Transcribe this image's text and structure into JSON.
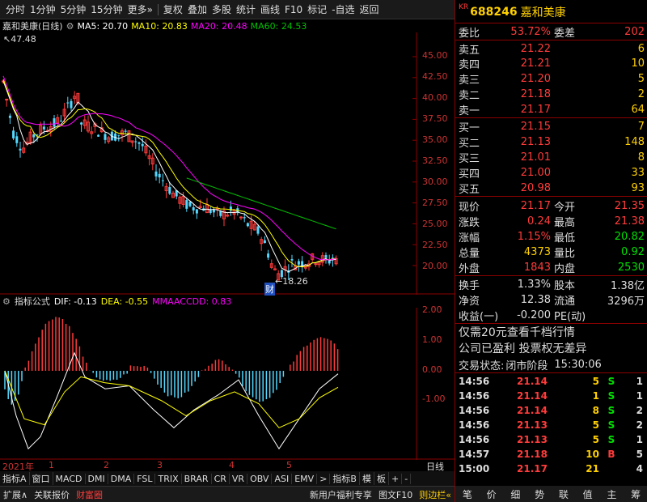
{
  "toolbar": {
    "items": [
      "分时",
      "1分钟",
      "5分钟",
      "15分钟",
      "更多»",
      "复权",
      "叠加",
      "多股",
      "统计",
      "画线",
      "F10",
      "标记",
      "-自选",
      "返回"
    ]
  },
  "chart": {
    "stock_label": "嘉和美康(日线)",
    "ma5": "MA5: 20.70",
    "ma10": "MA10: 20.83",
    "ma20": "MA20: 20.48",
    "ma60": "MA60: 24.53",
    "high_label": "47.48",
    "low_label": "←18.26",
    "cai_label": "财",
    "price_ticks": [
      "45.00",
      "42.50",
      "40.00",
      "37.50",
      "35.00",
      "32.50",
      "30.00",
      "27.50",
      "25.00",
      "22.50",
      "20.00"
    ]
  },
  "indicator": {
    "name": "指标公式",
    "dif": "DIF: -0.13",
    "dea": "DEA: -0.55",
    "mma": "MMAACCDD: 0.83",
    "ticks": [
      "2.00",
      "1.00",
      "0.00",
      "-1.00"
    ]
  },
  "xaxis": {
    "year": "2021年",
    "months": [
      "1",
      "2",
      "3",
      "4",
      "5"
    ],
    "right_label": "日线"
  },
  "tabs": {
    "items": [
      "指标A",
      "窗口",
      "MACD",
      "DMI",
      "DMA",
      "FSL",
      "TRIX",
      "BRAR",
      "CR",
      "VR",
      "OBV",
      "ASI",
      "EMV",
      ">",
      "指标B",
      "模",
      "板",
      "+",
      "-"
    ]
  },
  "bottombar": {
    "items": [
      "扩展∧",
      "关联报价",
      "财富圈"
    ],
    "right_items": [
      "新用户福利专享",
      "图文F10",
      "则边栏«"
    ]
  },
  "quote": {
    "kr": "KR",
    "code": "688246",
    "name": "嘉和美康",
    "weibi_label": "委比",
    "weibi": "53.72%",
    "weicha_label": "委差",
    "weicha": "202",
    "sells": [
      {
        "label": "卖五",
        "price": "21.22",
        "vol": "6"
      },
      {
        "label": "卖四",
        "price": "21.21",
        "vol": "10"
      },
      {
        "label": "卖三",
        "price": "21.20",
        "vol": "5"
      },
      {
        "label": "卖二",
        "price": "21.18",
        "vol": "2"
      },
      {
        "label": "卖一",
        "price": "21.17",
        "vol": "64"
      }
    ],
    "buys": [
      {
        "label": "买一",
        "price": "21.15",
        "vol": "7"
      },
      {
        "label": "买二",
        "price": "21.13",
        "vol": "148"
      },
      {
        "label": "买三",
        "price": "21.01",
        "vol": "8"
      },
      {
        "label": "买四",
        "price": "21.00",
        "vol": "33"
      },
      {
        "label": "买五",
        "price": "20.98",
        "vol": "93"
      }
    ],
    "stats": [
      {
        "l1": "现价",
        "v1": "21.17",
        "l2": "今开",
        "v2": "21.35",
        "c2": "#ff3b3b"
      },
      {
        "l1": "涨跌",
        "v1": "0.24",
        "l2": "最高",
        "v2": "21.38",
        "c2": "#ff3b3b"
      },
      {
        "l1": "涨幅",
        "v1": "1.15%",
        "l2": "最低",
        "v2": "20.82",
        "c2": "#00e000"
      },
      {
        "l1": "总量",
        "v1": "4373",
        "l2": "量比",
        "v2": "0.92",
        "c2": "#00e000"
      },
      {
        "l1": "外盘",
        "v1": "1843",
        "l2": "内盘",
        "v2": "2530",
        "c2": "#00e000"
      }
    ],
    "stats2": [
      {
        "l1": "换手",
        "v1": "1.33%",
        "l2": "股本",
        "v2": "1.38亿"
      },
      {
        "l1": "净资",
        "v1": "12.38",
        "l2": "流通",
        "v2": "3296万"
      },
      {
        "l1": "收益(一)",
        "v1": "-0.200",
        "l2": "PE(动)",
        "v2": ""
      }
    ],
    "notice1": "仅需20元查看千档行情",
    "notice2": "公司已盈利 投票权无差异",
    "status_label": "交易状态:",
    "status": "闭市阶段",
    "status_time": "15:30:06",
    "trades": [
      {
        "t": "14:56",
        "p": "21.14",
        "v": "5",
        "f": "S",
        "n": "1",
        "fc": "#00e000"
      },
      {
        "t": "14:56",
        "p": "21.14",
        "v": "1",
        "f": "S",
        "n": "1",
        "fc": "#00e000"
      },
      {
        "t": "14:56",
        "p": "21.14",
        "v": "8",
        "f": "S",
        "n": "2",
        "fc": "#00e000"
      },
      {
        "t": "14:56",
        "p": "21.13",
        "v": "5",
        "f": "S",
        "n": "2",
        "fc": "#00e000"
      },
      {
        "t": "14:56",
        "p": "21.13",
        "v": "5",
        "f": "S",
        "n": "1",
        "fc": "#00e000"
      },
      {
        "t": "14:57",
        "p": "21.18",
        "v": "10",
        "f": "B",
        "n": "5",
        "fc": "#ff3b3b"
      },
      {
        "t": "15:00",
        "p": "21.17",
        "v": "21",
        "f": "",
        "n": "4",
        "fc": "#ddd"
      }
    ],
    "bottom_tabs": [
      "笔",
      "价",
      "细",
      "势",
      "联",
      "值",
      "主",
      "筹"
    ]
  },
  "colors": {
    "up": "#ff3b3b",
    "down": "#54d8ff",
    "ma5": "#ffffff",
    "ma10": "#ffff00",
    "ma20": "#ff00ff",
    "ma60": "#00c000"
  }
}
